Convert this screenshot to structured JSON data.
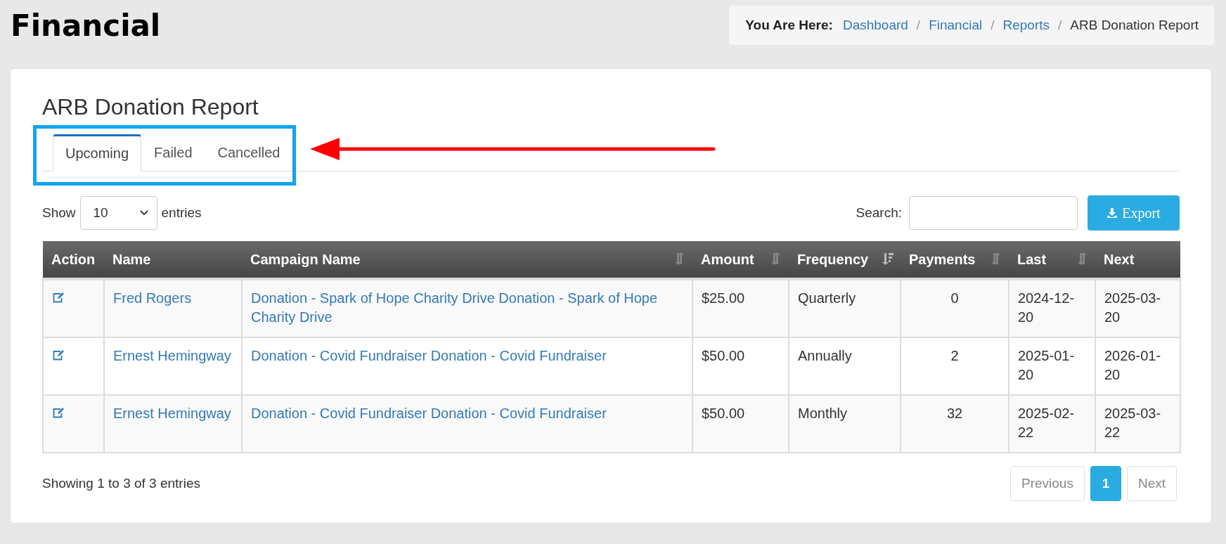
{
  "page_title": "Financial",
  "breadcrumb": {
    "label": "You Are Here:",
    "separator": "/",
    "items": [
      {
        "text": "Dashboard",
        "link": true
      },
      {
        "text": "Financial",
        "link": true
      },
      {
        "text": "Reports",
        "link": true
      },
      {
        "text": "ARB Donation Report",
        "link": false
      }
    ]
  },
  "report_title": "ARB Donation Report",
  "tabs": [
    {
      "label": "Upcoming",
      "selected": true
    },
    {
      "label": "Failed",
      "selected": false
    },
    {
      "label": "Cancelled",
      "selected": false
    }
  ],
  "length": {
    "before": "Show",
    "value": "10",
    "after": "entries"
  },
  "search": {
    "label": "Search:"
  },
  "export_button": "Export",
  "table": {
    "columns": [
      {
        "label": "Action",
        "sortable": false
      },
      {
        "label": "Name",
        "sortable": false
      },
      {
        "label": "Campaign Name",
        "sortable": true,
        "sorted": false
      },
      {
        "label": "Amount",
        "sortable": true,
        "sorted": false
      },
      {
        "label": "Frequency",
        "sortable": true,
        "sorted": true
      },
      {
        "label": "Payments",
        "sortable": true,
        "sorted": false
      },
      {
        "label": "Last",
        "sortable": true,
        "sorted": false
      },
      {
        "label": "Next",
        "sortable": false
      }
    ],
    "rows": [
      {
        "name": "Fred Rogers",
        "campaign": "Donation - Spark of Hope Charity Drive Donation - Spark of Hope Charity Drive",
        "amount": "$25.00",
        "frequency": "Quarterly",
        "payments": "0",
        "last": "2024-12-20",
        "next": "2025-03-20"
      },
      {
        "name": "Ernest Hemingway",
        "campaign": "Donation - Covid Fundraiser Donation - Covid Fundraiser",
        "amount": "$50.00",
        "frequency": "Annually",
        "payments": "2",
        "last": "2025-01-20",
        "next": "2026-01-20"
      },
      {
        "name": "Ernest Hemingway",
        "campaign": "Donation - Covid Fundraiser Donation - Covid Fundraiser",
        "amount": "$50.00",
        "frequency": "Monthly",
        "payments": "32",
        "last": "2025-02-22",
        "next": "2025-03-22"
      }
    ]
  },
  "info": "Showing 1 to 3 of 3 entries",
  "pagination": [
    {
      "label": "Previous",
      "selected": false
    },
    {
      "label": "1",
      "selected": true
    },
    {
      "label": "Next",
      "selected": false
    }
  ]
}
